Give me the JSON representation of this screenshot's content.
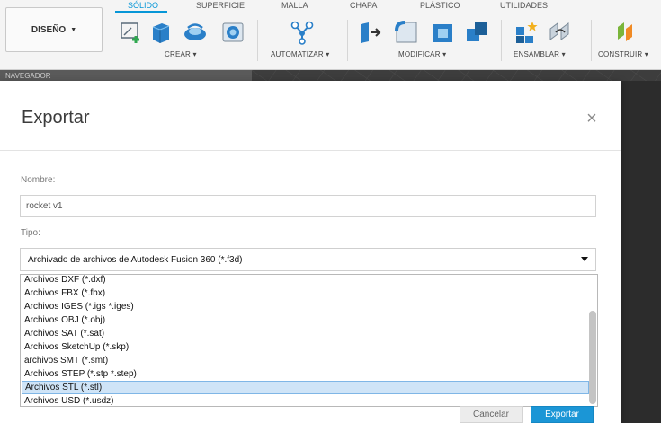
{
  "toolbar": {
    "design_label": "DISEÑO",
    "tabs": [
      "SÓLIDO",
      "SUPERFICIE",
      "MALLA",
      "CHAPA",
      "PLÁSTICO",
      "UTILIDADES"
    ],
    "groups": [
      "CREAR",
      "AUTOMATIZAR",
      "MODIFICAR",
      "ENSAMBLAR",
      "CONSTRUIR"
    ],
    "accent_color": "#0696d7"
  },
  "browser": {
    "title": "NAVEGADOR"
  },
  "dialog": {
    "title": "Exportar",
    "close_icon": "close-icon",
    "name_label": "Nombre:",
    "name_value": "rocket v1",
    "type_label": "Tipo:",
    "type_selected": "Archivado de archivos de Autodesk Fusion 360 (*.f3d)",
    "options": [
      "Archivos DXF (*.dxf)",
      "Archivos FBX (*.fbx)",
      "Archivos IGES (*.igs *.iges)",
      "Archivos OBJ (*.obj)",
      "Archivos SAT (*.sat)",
      "Archivos SketchUp (*.skp)",
      "archivos SMT (*.smt)",
      "Archivos STEP (*.stp *.step)",
      "Archivos STL (*.stl)",
      "Archivos USD (*.usdz)"
    ],
    "highlighted_option": "Archivos STL (*.stl)",
    "cancel_label": "Cancelar",
    "export_label": "Exportar",
    "export_color": "#1b96d6"
  }
}
